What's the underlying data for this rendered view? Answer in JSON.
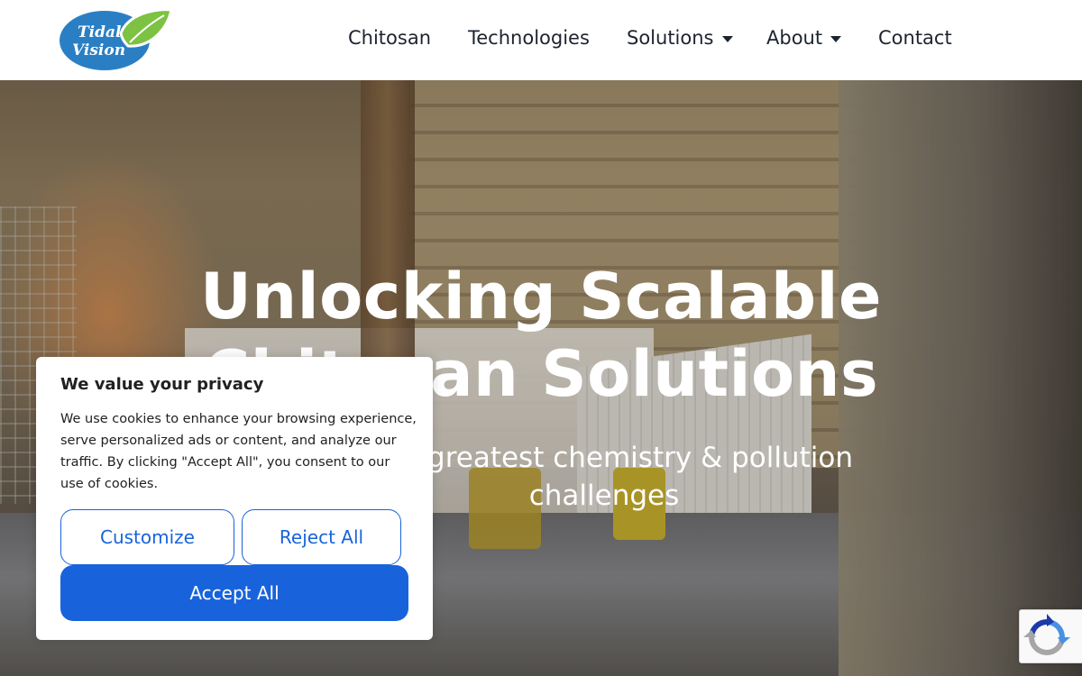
{
  "header": {
    "logo": {
      "text_line1": "Tidal",
      "text_line2": "Vision",
      "brand_blue": "#2a7fc4",
      "leaf_green": "#7dc242"
    },
    "nav": [
      {
        "label": "Chitosan",
        "has_dropdown": false
      },
      {
        "label": "Technologies",
        "has_dropdown": false
      },
      {
        "label": "Solutions",
        "has_dropdown": true
      },
      {
        "label": "About",
        "has_dropdown": true
      },
      {
        "label": "Contact",
        "has_dropdown": false
      }
    ]
  },
  "hero": {
    "title_line1": "Unlocking Scalable",
    "title_line2": "Chitosan Solutions",
    "subtitle_line1": "greatest chemistry & pollution",
    "subtitle_line2": "challenges"
  },
  "cookie_banner": {
    "title": "We value your privacy",
    "body": "We use cookies to enhance your browsing experience, serve personalized ads or content, and analyze our traffic. By clicking \"Accept All\", you consent to our use of cookies.",
    "customize_label": "Customize",
    "reject_label": "Reject All",
    "accept_label": "Accept All",
    "accent_color": "#1863dc"
  },
  "recaptcha": {
    "icon": "recaptcha-icon"
  }
}
